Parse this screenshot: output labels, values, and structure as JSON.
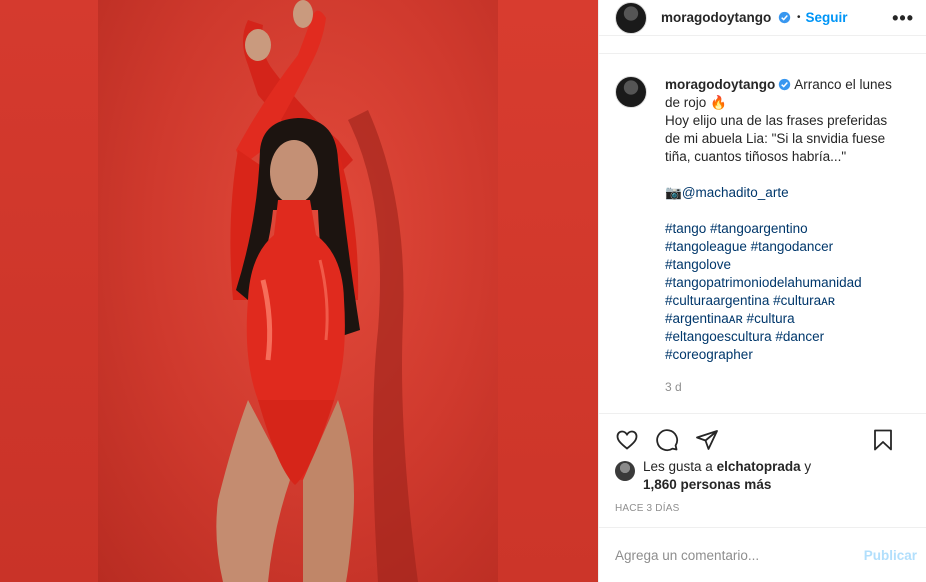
{
  "post": {
    "username": "moragodoytango",
    "follow_label": "Seguir",
    "dot": "•",
    "more": "•••"
  },
  "caption": {
    "username": "moragodoytango",
    "line1": "Arranco el lunes",
    "line2": "de rojo 🔥",
    "line3": "Hoy elijo una de las frases preferidas",
    "line4": "de mi abuela Lia: \"Si la snvidia fuese",
    "line5": "tiña, cuantos tiñosos habría...\"",
    "camera": "📷",
    "mention": "@machadito_arte",
    "tags": [
      "#tango #tangoargentino",
      "#tangoleague #tangodancer",
      "#tangolove",
      "#tangopatrimoniodelahumanidad",
      "#culturaargentina #culturaᴀʀ",
      "#argentinaᴀʀ #cultura",
      "#eltangoescultura #dancer",
      "#coreographer"
    ],
    "time": "3 d"
  },
  "likes": {
    "prefix": "Les gusta a",
    "user": "elchatoprada",
    "conj": "y",
    "count": "1,860 personas más"
  },
  "posted_ago": "HACE 3 DÍAS",
  "comment_box": {
    "placeholder": "Agrega un comentario...",
    "publish": "Publicar"
  },
  "icons": {
    "like": "heart-icon",
    "comment": "comment-icon",
    "share": "share-icon",
    "save": "bookmark-icon",
    "verified": "verified-badge-icon"
  },
  "colors": {
    "accent": "#0095f6",
    "background_red": "#d33a2c"
  }
}
